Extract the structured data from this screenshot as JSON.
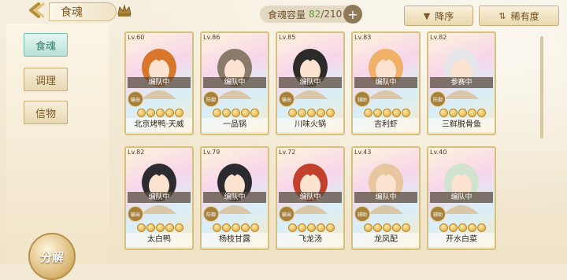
{
  "header": {
    "title": "食魂",
    "capacity_label": "食魂容量",
    "capacity_current": "82",
    "capacity_max": "/210",
    "add_label": "+",
    "sort_desc_label": "降序",
    "sort_rarity_label": "稀有度"
  },
  "sidebar": {
    "tabs": [
      {
        "label": "食魂",
        "active": true
      },
      {
        "label": "调理",
        "active": false
      },
      {
        "label": "信物",
        "active": false
      }
    ],
    "decompose_label": "分解"
  },
  "cards": [
    {
      "level": "Lv.60",
      "status": "编队中",
      "name": "北京烤鸭·天威",
      "role": "输出",
      "stars": 5,
      "hair": "#d8772b"
    },
    {
      "level": "Lv.86",
      "status": "编队中",
      "name": "一品锅",
      "role": "防御",
      "stars": 5,
      "hair": "#8a7a6a"
    },
    {
      "level": "Lv.85",
      "status": "编队中",
      "name": "川味火锅",
      "role": "输出",
      "stars": 5,
      "hair": "#2d2a2a"
    },
    {
      "level": "Lv.83",
      "status": "编队中",
      "name": "吉利虾",
      "role": "辅助",
      "stars": 5,
      "hair": "#f0b06a"
    },
    {
      "level": "Lv.82",
      "status": "参赛中",
      "name": "三鲜脱骨鱼",
      "role": "防御",
      "stars": 5,
      "hair": "#e6e6ea"
    },
    {
      "level": "Lv.82",
      "status": "编队中",
      "name": "太白鸭",
      "role": "输出",
      "stars": 5,
      "hair": "#2c2c30"
    },
    {
      "level": "Lv.79",
      "status": "编队中",
      "name": "杨枝甘露",
      "role": "防御",
      "stars": 5,
      "hair": "#2b2a2e"
    },
    {
      "level": "Lv.72",
      "status": "编队中",
      "name": "飞龙汤",
      "role": "输出",
      "stars": 5,
      "hair": "#c1412c"
    },
    {
      "level": "Lv.43",
      "status": "编队中",
      "name": "龙凤配",
      "role": "辅助",
      "stars": 5,
      "hair": "#e8c7a0"
    },
    {
      "level": "Lv.40",
      "status": "编队中",
      "name": "开水白菜",
      "role": "辅助",
      "stars": 5,
      "hair": "#cfe3cf"
    }
  ]
}
